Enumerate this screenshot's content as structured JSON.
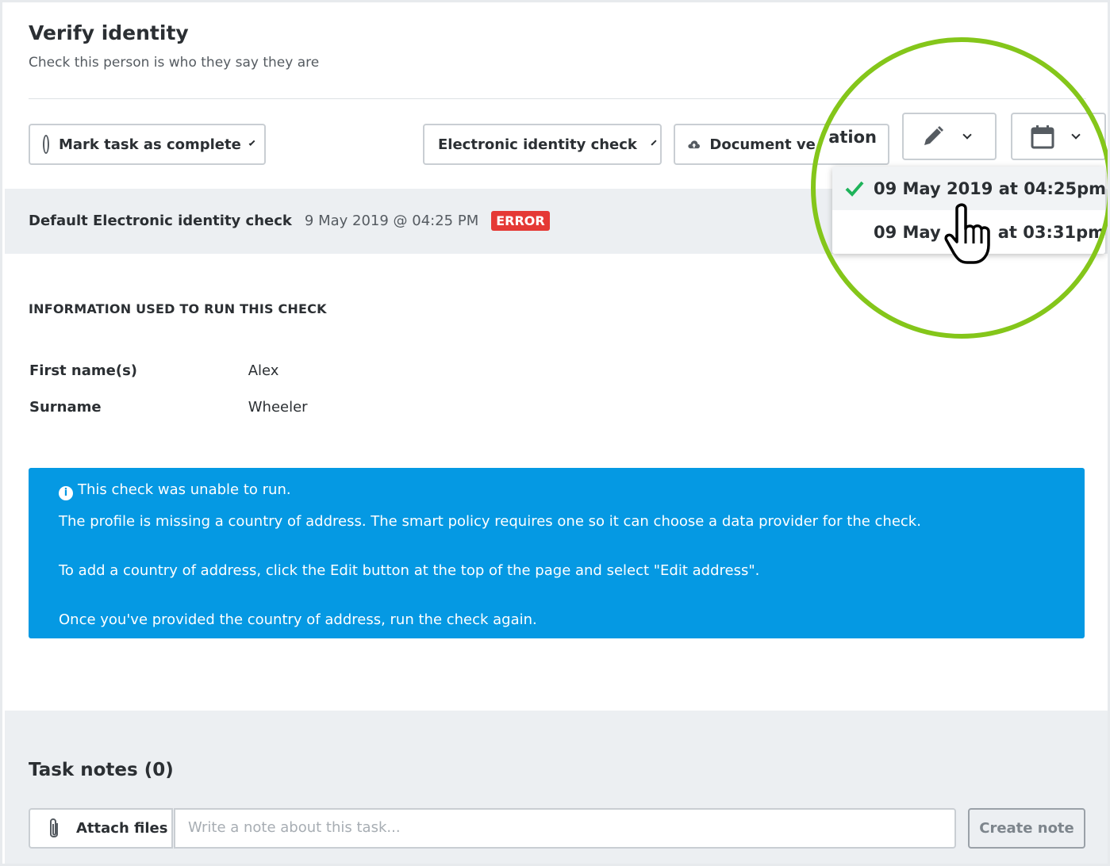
{
  "header": {
    "title": "Verify identity",
    "subtitle": "Check this person is who they say they are"
  },
  "toolbar": {
    "mark_complete_label": "Mark task as complete",
    "electronic_check_label": "Electronic identity check",
    "document_label_left": "Document ve",
    "document_label_right": "ation",
    "edit_icon": "pencil-icon",
    "calendar_icon": "calendar-icon"
  },
  "check": {
    "title": "Default Electronic identity check",
    "date": "9 May 2019 @ 04:25 PM",
    "status": "ERROR"
  },
  "info": {
    "section_label": "INFORMATION USED TO RUN THIS CHECK",
    "fields": [
      {
        "label": "First name(s)",
        "value": "Alex"
      },
      {
        "label": "Surname",
        "value": "Wheeler"
      }
    ]
  },
  "alert": {
    "heading": "This check was unable to run.",
    "line1": "The profile is missing a country of address. The smart policy requires one so it can choose a data provider for the check.",
    "line2": "To add a country of address, click the Edit button at the top of the page and select \"Edit address\".",
    "line3": "Once you've provided the country of address, run the check again."
  },
  "dropdown": {
    "items": [
      {
        "label": "09 May 2019 at 04:25pm",
        "selected": true
      },
      {
        "label_left": "09 May",
        "label_right": "at 03:31pm",
        "selected": false
      }
    ]
  },
  "notes": {
    "title": "Task notes (0)",
    "attach_label": "Attach files",
    "placeholder": "Write a note about this task...",
    "create_label": "Create note"
  },
  "colors": {
    "accent_blue": "#0599e3",
    "error_red": "#e53935",
    "highlight_green": "#84c61a",
    "check_green": "#1fb35a"
  }
}
